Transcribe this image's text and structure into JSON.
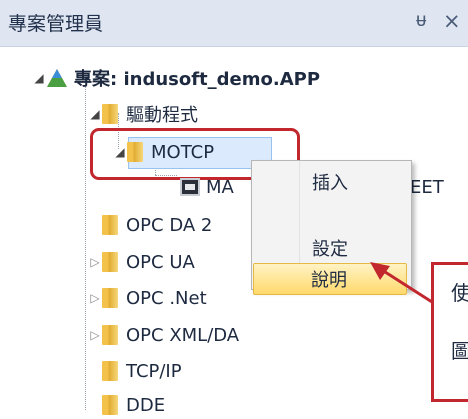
{
  "panel": {
    "title": "專案管理員",
    "pin_glyph": "ᵾ",
    "close_glyph": "×"
  },
  "tree": {
    "project_label": "專案: indusoft_demo.APP",
    "drivers_label": "驅動程式",
    "motcp_label": "MOTCP",
    "child_label": "MA",
    "child_suffix": "EET",
    "folders": [
      {
        "label": "OPC DA 2"
      },
      {
        "label": "OPC UA"
      },
      {
        "label": "OPC .Net"
      },
      {
        "label": "OPC XML/DA"
      },
      {
        "label": "TCP/IP"
      },
      {
        "label": "DDE"
      }
    ]
  },
  "context_menu": {
    "items": [
      {
        "label": "插入"
      },
      {
        "label": "設定"
      },
      {
        "label": "說明"
      }
    ]
  },
  "callout": {
    "line1": "使",
    "line2": "圖"
  },
  "colors": {
    "annotation_red": "#c1272d",
    "selection_bg": "#dbeafd",
    "menu_highlight": "#ffd96b"
  }
}
